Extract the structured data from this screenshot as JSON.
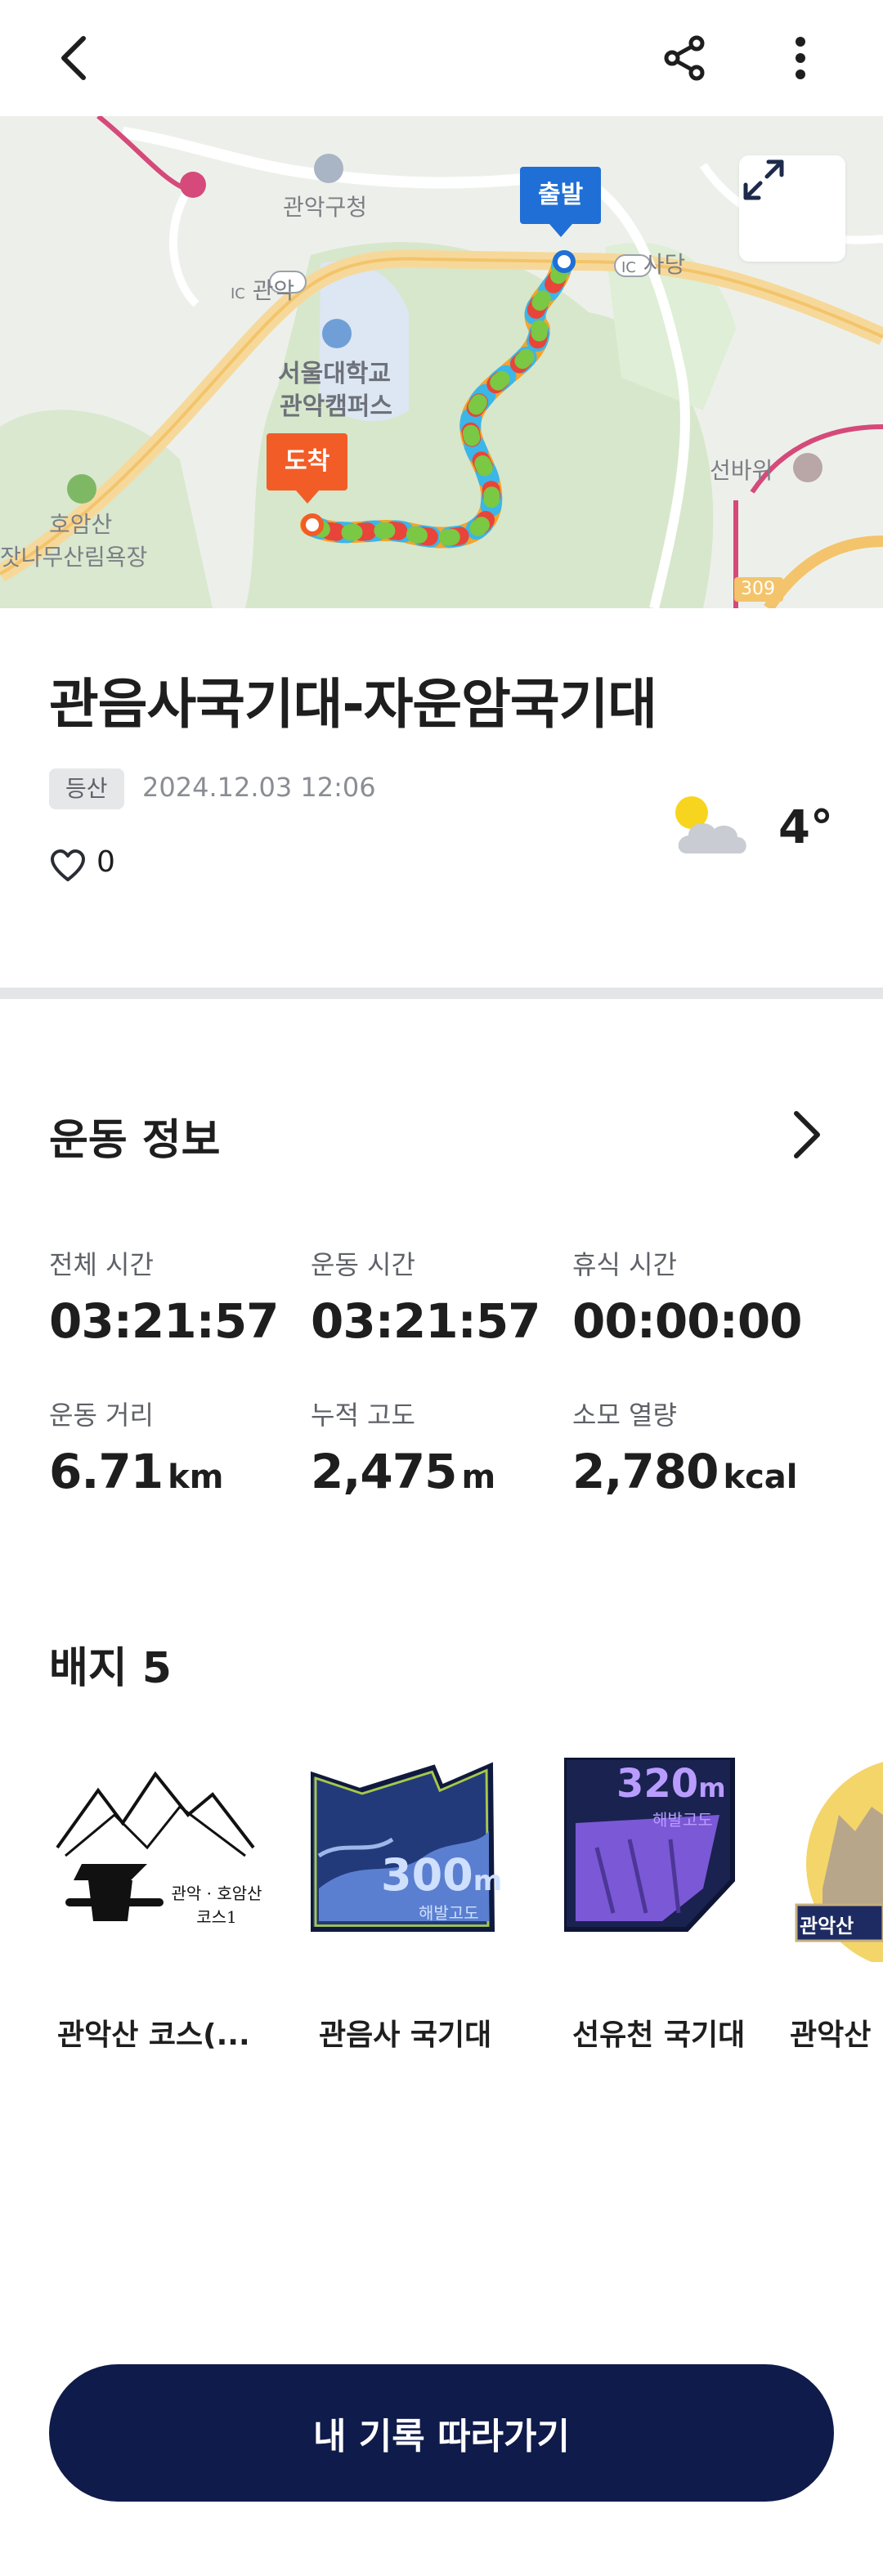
{
  "header": {
    "back_icon": "chevron-left-icon",
    "share_icon": "share-icon",
    "more_icon": "more-vertical-icon"
  },
  "map": {
    "labels": {
      "gwanak_gucheong": "관악구청",
      "gwanak_ic": "관악",
      "sadang_ic": "사당",
      "snu_line1": "서울대학교",
      "snu_line2": "관악캠퍼스",
      "hoamsan_line1": "호암산",
      "hoamsan_line2": "잣나무산림욕장",
      "seonbawi": "선바위",
      "route309": "309",
      "ic": "IC"
    },
    "start_pin": "출발",
    "end_pin": "도착",
    "expand_icon": "expand-icon"
  },
  "activity": {
    "title": "관음사국기대-자운암국기대",
    "tag": "등산",
    "datetime": "2024.12.03 12:06",
    "likes": "0",
    "weather_icon": "partly-cloudy-icon",
    "temperature": "4°"
  },
  "exercise": {
    "title": "운동 정보",
    "stats": [
      {
        "label": "전체 시간",
        "value": "03:21:57",
        "unit": ""
      },
      {
        "label": "운동 시간",
        "value": "03:21:57",
        "unit": ""
      },
      {
        "label": "휴식 시간",
        "value": "00:00:00",
        "unit": ""
      },
      {
        "label": "운동 거리",
        "value": "6.71",
        "unit": "km"
      },
      {
        "label": "누적 고도",
        "value": "2,475",
        "unit": "m"
      },
      {
        "label": "소모 열량",
        "value": "2,780",
        "unit": "kcal"
      }
    ]
  },
  "badges": {
    "title": "배지 5",
    "items": [
      {
        "name": "관악산 코스(...",
        "art_text": "관악 · 호암산 코스1"
      },
      {
        "name": "관음사 국기대",
        "art_value": "300",
        "art_unit": "m",
        "art_sub": "해발고도"
      },
      {
        "name": "선유천 국기대",
        "art_value": "320",
        "art_unit": "m",
        "art_sub": "해발고도"
      },
      {
        "name": "관악산",
        "art_text": "관악산"
      }
    ]
  },
  "cta": {
    "label": "내 기록 따라가기"
  },
  "colors": {
    "primary_navy": "#0f1b4a",
    "start_pin": "#1f6fd6",
    "end_pin": "#f25c27"
  }
}
